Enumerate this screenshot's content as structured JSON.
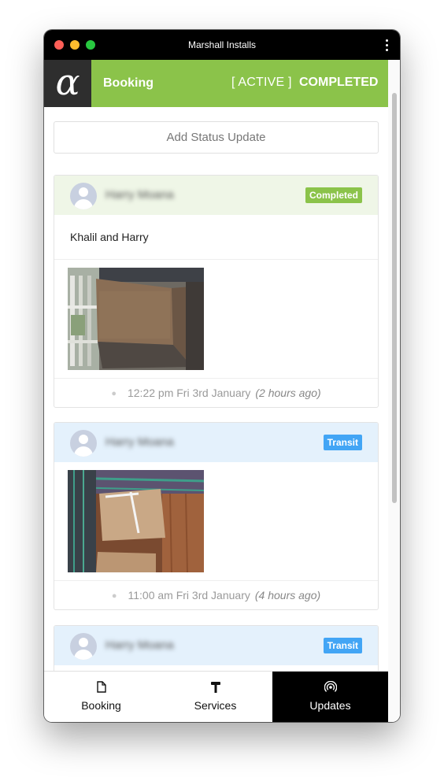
{
  "window": {
    "title": "Marshall Installs"
  },
  "header": {
    "logo_glyph": "α",
    "title": "Booking",
    "tab_active": "[ ACTIVE ]",
    "tab_completed": "COMPLETED",
    "accent_color": "#8bc34a"
  },
  "main": {
    "add_status_label": "Add Status Update",
    "updates": [
      {
        "author": "Harry Moana",
        "status": "Completed",
        "status_color": "#8bc34a",
        "note": "Khalil and Harry",
        "time": "12:22 pm Fri 3rd January",
        "ago": "(2 hours ago)"
      },
      {
        "author": "Harry Moana",
        "status": "Transit",
        "status_color": "#42a5f5",
        "time": "11:00 am Fri 3rd January",
        "ago": "(4 hours ago)"
      },
      {
        "author": "Harry Moana",
        "status": "Transit",
        "status_color": "#42a5f5"
      }
    ]
  },
  "nav": {
    "items": [
      {
        "label": "Booking",
        "icon": "document-icon"
      },
      {
        "label": "Services",
        "icon": "hammer-icon"
      },
      {
        "label": "Updates",
        "icon": "broadcast-icon",
        "selected": true
      }
    ]
  }
}
